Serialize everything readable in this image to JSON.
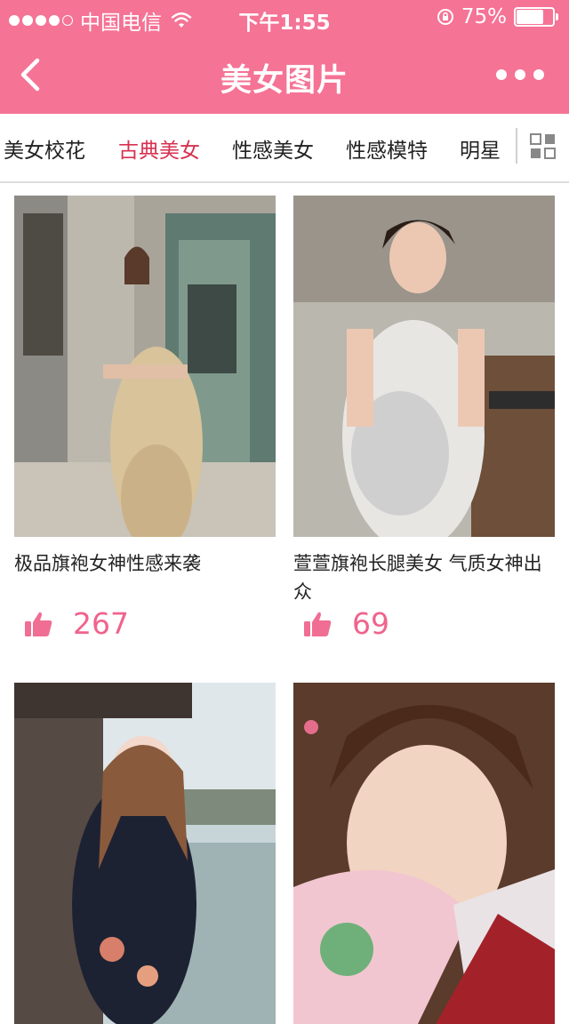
{
  "status_bar": {
    "carrier": "中国电信",
    "time": "下午1:55",
    "battery": "75%",
    "battery_level": 0.75
  },
  "nav": {
    "title": "美女图片",
    "back_icon": "chevron-left-icon",
    "more_icon": "more-dots-icon"
  },
  "tabs": [
    {
      "label": "美女校花"
    },
    {
      "label": "古典美女",
      "active": true
    },
    {
      "label": "性感美女"
    },
    {
      "label": "性感模特"
    },
    {
      "label": "明星"
    }
  ],
  "cards": [
    {
      "caption": "极品旗袍女神性感来袭",
      "likes": "267"
    },
    {
      "caption": "萱萱旗袍长腿美女 气质女神出众",
      "likes": "69"
    },
    {
      "caption": "",
      "likes": ""
    },
    {
      "caption": "",
      "likes": ""
    }
  ],
  "colors": {
    "brand": "#f57395",
    "active_tab": "#d6314f",
    "like": "#f0638c"
  }
}
